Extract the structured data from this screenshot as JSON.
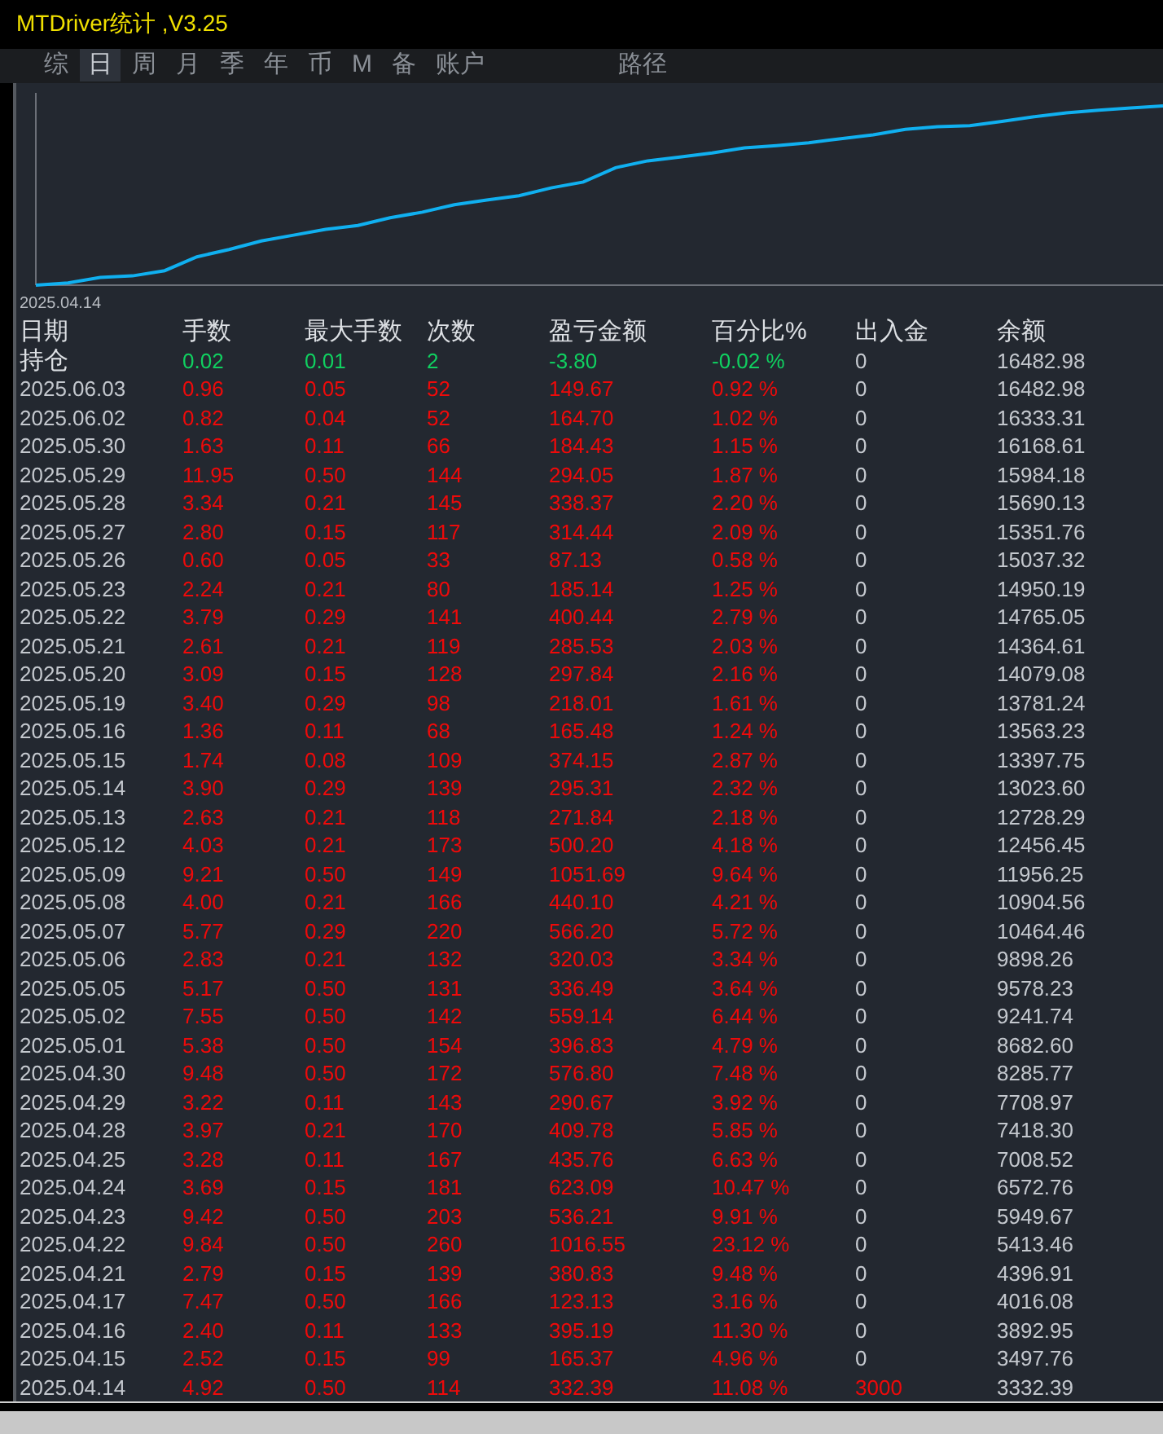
{
  "window": {
    "title": "MTDriver统计 ,V3.25"
  },
  "tabs": [
    {
      "label": "综",
      "selected": false
    },
    {
      "label": "日",
      "selected": true
    },
    {
      "label": "周",
      "selected": false
    },
    {
      "label": "月",
      "selected": false
    },
    {
      "label": "季",
      "selected": false
    },
    {
      "label": "年",
      "selected": false
    },
    {
      "label": "币",
      "selected": false
    },
    {
      "label": "M",
      "selected": false
    },
    {
      "label": "备",
      "selected": false
    },
    {
      "label": "账户",
      "selected": false
    }
  ],
  "path_button": {
    "label": "路径"
  },
  "chart": {
    "start_label": "2025.04.14"
  },
  "table": {
    "columns": [
      "日期",
      "手数",
      "最大手数",
      "次数",
      "盈亏金额",
      "百分比%",
      "出入金",
      "余额"
    ],
    "rows": [
      {
        "kind": "position",
        "cells": [
          "持仓",
          "0.02",
          "0.01",
          "2",
          "-3.80",
          "-0.02 %",
          "0",
          "16482.98"
        ]
      },
      {
        "kind": "day",
        "cells": [
          "2025.06.03",
          "0.96",
          "0.05",
          "52",
          "149.67",
          "0.92 %",
          "0",
          "16482.98"
        ]
      },
      {
        "kind": "day",
        "cells": [
          "2025.06.02",
          "0.82",
          "0.04",
          "52",
          "164.70",
          "1.02 %",
          "0",
          "16333.31"
        ]
      },
      {
        "kind": "day",
        "cells": [
          "2025.05.30",
          "1.63",
          "0.11",
          "66",
          "184.43",
          "1.15 %",
          "0",
          "16168.61"
        ]
      },
      {
        "kind": "day",
        "cells": [
          "2025.05.29",
          "11.95",
          "0.50",
          "144",
          "294.05",
          "1.87 %",
          "0",
          "15984.18"
        ]
      },
      {
        "kind": "day",
        "cells": [
          "2025.05.28",
          "3.34",
          "0.21",
          "145",
          "338.37",
          "2.20 %",
          "0",
          "15690.13"
        ]
      },
      {
        "kind": "day",
        "cells": [
          "2025.05.27",
          "2.80",
          "0.15",
          "117",
          "314.44",
          "2.09 %",
          "0",
          "15351.76"
        ]
      },
      {
        "kind": "day",
        "cells": [
          "2025.05.26",
          "0.60",
          "0.05",
          "33",
          "87.13",
          "0.58 %",
          "0",
          "15037.32"
        ]
      },
      {
        "kind": "day",
        "cells": [
          "2025.05.23",
          "2.24",
          "0.21",
          "80",
          "185.14",
          "1.25 %",
          "0",
          "14950.19"
        ]
      },
      {
        "kind": "day",
        "cells": [
          "2025.05.22",
          "3.79",
          "0.29",
          "141",
          "400.44",
          "2.79 %",
          "0",
          "14765.05"
        ]
      },
      {
        "kind": "day",
        "cells": [
          "2025.05.21",
          "2.61",
          "0.21",
          "119",
          "285.53",
          "2.03 %",
          "0",
          "14364.61"
        ]
      },
      {
        "kind": "day",
        "cells": [
          "2025.05.20",
          "3.09",
          "0.15",
          "128",
          "297.84",
          "2.16 %",
          "0",
          "14079.08"
        ]
      },
      {
        "kind": "day",
        "cells": [
          "2025.05.19",
          "3.40",
          "0.29",
          "98",
          "218.01",
          "1.61 %",
          "0",
          "13781.24"
        ]
      },
      {
        "kind": "day",
        "cells": [
          "2025.05.16",
          "1.36",
          "0.11",
          "68",
          "165.48",
          "1.24 %",
          "0",
          "13563.23"
        ]
      },
      {
        "kind": "day",
        "cells": [
          "2025.05.15",
          "1.74",
          "0.08",
          "109",
          "374.15",
          "2.87 %",
          "0",
          "13397.75"
        ]
      },
      {
        "kind": "day",
        "cells": [
          "2025.05.14",
          "3.90",
          "0.29",
          "139",
          "295.31",
          "2.32 %",
          "0",
          "13023.60"
        ]
      },
      {
        "kind": "day",
        "cells": [
          "2025.05.13",
          "2.63",
          "0.21",
          "118",
          "271.84",
          "2.18 %",
          "0",
          "12728.29"
        ]
      },
      {
        "kind": "day",
        "cells": [
          "2025.05.12",
          "4.03",
          "0.21",
          "173",
          "500.20",
          "4.18 %",
          "0",
          "12456.45"
        ]
      },
      {
        "kind": "day",
        "cells": [
          "2025.05.09",
          "9.21",
          "0.50",
          "149",
          "1051.69",
          "9.64 %",
          "0",
          "11956.25"
        ]
      },
      {
        "kind": "day",
        "cells": [
          "2025.05.08",
          "4.00",
          "0.21",
          "166",
          "440.10",
          "4.21 %",
          "0",
          "10904.56"
        ]
      },
      {
        "kind": "day",
        "cells": [
          "2025.05.07",
          "5.77",
          "0.29",
          "220",
          "566.20",
          "5.72 %",
          "0",
          "10464.46"
        ]
      },
      {
        "kind": "day",
        "cells": [
          "2025.05.06",
          "2.83",
          "0.21",
          "132",
          "320.03",
          "3.34 %",
          "0",
          "9898.26"
        ]
      },
      {
        "kind": "day",
        "cells": [
          "2025.05.05",
          "5.17",
          "0.50",
          "131",
          "336.49",
          "3.64 %",
          "0",
          "9578.23"
        ]
      },
      {
        "kind": "day",
        "cells": [
          "2025.05.02",
          "7.55",
          "0.50",
          "142",
          "559.14",
          "6.44 %",
          "0",
          "9241.74"
        ]
      },
      {
        "kind": "day",
        "cells": [
          "2025.05.01",
          "5.38",
          "0.50",
          "154",
          "396.83",
          "4.79 %",
          "0",
          "8682.60"
        ]
      },
      {
        "kind": "day",
        "cells": [
          "2025.04.30",
          "9.48",
          "0.50",
          "172",
          "576.80",
          "7.48 %",
          "0",
          "8285.77"
        ]
      },
      {
        "kind": "day",
        "cells": [
          "2025.04.29",
          "3.22",
          "0.11",
          "143",
          "290.67",
          "3.92 %",
          "0",
          "7708.97"
        ]
      },
      {
        "kind": "day",
        "cells": [
          "2025.04.28",
          "3.97",
          "0.21",
          "170",
          "409.78",
          "5.85 %",
          "0",
          "7418.30"
        ]
      },
      {
        "kind": "day",
        "cells": [
          "2025.04.25",
          "3.28",
          "0.11",
          "167",
          "435.76",
          "6.63 %",
          "0",
          "7008.52"
        ]
      },
      {
        "kind": "day",
        "cells": [
          "2025.04.24",
          "3.69",
          "0.15",
          "181",
          "623.09",
          "10.47 %",
          "0",
          "6572.76"
        ]
      },
      {
        "kind": "day",
        "cells": [
          "2025.04.23",
          "9.42",
          "0.50",
          "203",
          "536.21",
          "9.91 %",
          "0",
          "5949.67"
        ]
      },
      {
        "kind": "day",
        "cells": [
          "2025.04.22",
          "9.84",
          "0.50",
          "260",
          "1016.55",
          "23.12 %",
          "0",
          "5413.46"
        ]
      },
      {
        "kind": "day",
        "cells": [
          "2025.04.21",
          "2.79",
          "0.15",
          "139",
          "380.83",
          "9.48 %",
          "0",
          "4396.91"
        ]
      },
      {
        "kind": "day",
        "cells": [
          "2025.04.17",
          "7.47",
          "0.50",
          "166",
          "123.13",
          "3.16 %",
          "0",
          "4016.08"
        ]
      },
      {
        "kind": "day",
        "cells": [
          "2025.04.16",
          "2.40",
          "0.11",
          "133",
          "395.19",
          "11.30 %",
          "0",
          "3892.95"
        ]
      },
      {
        "kind": "day",
        "cells": [
          "2025.04.15",
          "2.52",
          "0.15",
          "99",
          "165.37",
          "4.96 %",
          "0",
          "3497.76"
        ]
      },
      {
        "kind": "deposit",
        "cells": [
          "2025.04.14",
          "4.92",
          "0.50",
          "114",
          "332.39",
          "11.08 %",
          "3000",
          "3332.39"
        ]
      }
    ]
  }
}
